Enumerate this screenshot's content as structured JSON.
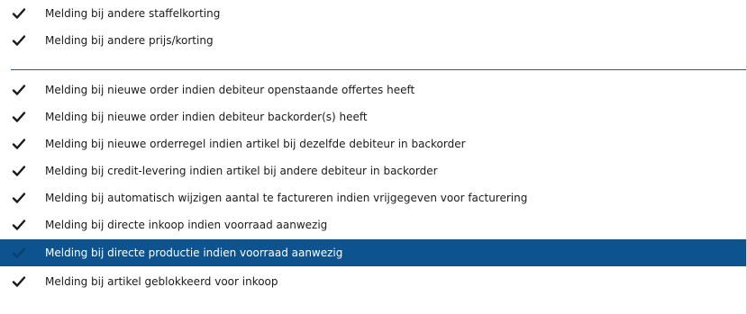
{
  "menu": {
    "items": [
      {
        "label": "Melding bij andere staffelkorting",
        "checked": true,
        "selected": false
      },
      {
        "label": "Melding bij andere prijs/korting",
        "checked": true,
        "selected": false
      },
      {
        "label": "Melding bij nieuwe order indien debiteur openstaande offertes heeft",
        "checked": true,
        "selected": false
      },
      {
        "label": "Melding bij nieuwe order indien debiteur backorder(s) heeft",
        "checked": true,
        "selected": false
      },
      {
        "label": "Melding bij nieuwe orderregel indien artikel bij dezelfde debiteur in backorder",
        "checked": true,
        "selected": false
      },
      {
        "label": "Melding bij credit-levering indien artikel bij andere debiteur in backorder",
        "checked": true,
        "selected": false
      },
      {
        "label": "Melding bij automatisch wijzigen aantal te factureren indien vrijgegeven voor facturering",
        "checked": true,
        "selected": false
      },
      {
        "label": "Melding bij directe inkoop indien voorraad aanwezig",
        "checked": true,
        "selected": false
      },
      {
        "label": "Melding bij directe productie indien voorraad aanwezig",
        "checked": true,
        "selected": true
      },
      {
        "label": "Melding bij artikel geblokkeerd voor inkoop",
        "checked": true,
        "selected": false
      }
    ],
    "colors": {
      "selection_background": "#0d5390",
      "selection_text": "#ffffff",
      "separator": "#1d5f9b",
      "check": "#1a1a1a"
    },
    "icons": {
      "check": "checkmark-icon"
    }
  }
}
